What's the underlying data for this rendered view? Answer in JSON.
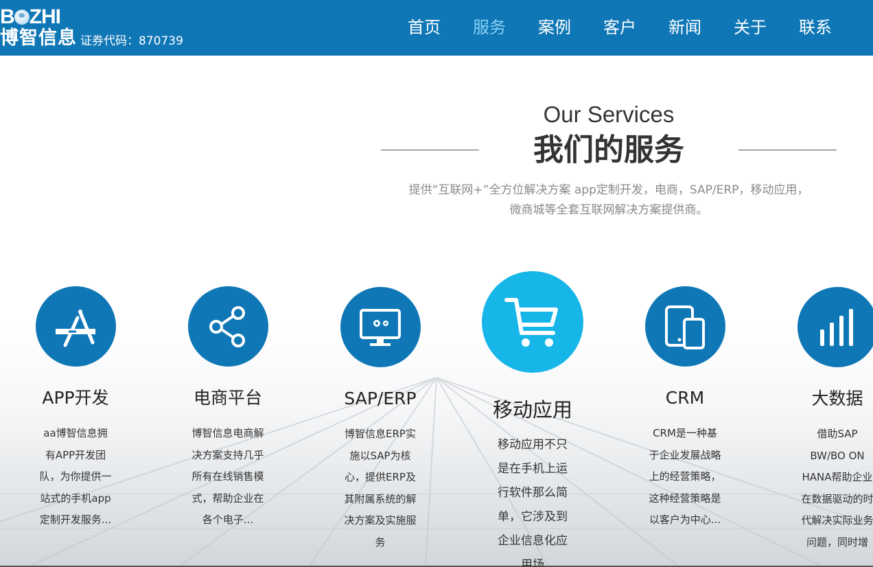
{
  "header": {
    "logo_en_prefix": "B",
    "logo_en_suffix": "ZHI",
    "logo_cn": "博智信息",
    "stock_code": "证券代码：870739",
    "nav": [
      {
        "label": "首页"
      },
      {
        "label": "服务",
        "active": true
      },
      {
        "label": "案例"
      },
      {
        "label": "客户"
      },
      {
        "label": "新闻"
      },
      {
        "label": "关于"
      },
      {
        "label": "联系"
      }
    ]
  },
  "section": {
    "title_en": "Our Services",
    "title_cn": "我们的服务",
    "subtitle": "提供“互联网+”全方位解决方案 app定制开发，电商，SAP/ERP，移动应用，微商城等全套互联网解决方案提供商。"
  },
  "services": [
    {
      "name": "APP开发",
      "icon": "app-store-icon",
      "desc": "aa博智信息拥有APP开发团队，为你提供一站式的手机app定制开发服务..."
    },
    {
      "name": "电商平台",
      "icon": "share-icon",
      "desc": "博智信息电商解决方案支持几乎所有在线销售模式，帮助企业在各个电子..."
    },
    {
      "name": "SAP/ERP",
      "icon": "monitor-gears-icon",
      "desc": "博智信息ERP实施以SAP为核心，提供ERP及其附属系统的解决方案及实施服务"
    },
    {
      "name": "移动应用",
      "icon": "shopping-cart-icon",
      "desc": "移动应用不只是在手机上运行软件那么简单，它涉及到企业信息化应用场",
      "active": true
    },
    {
      "name": "CRM",
      "icon": "tablet-phone-icon",
      "desc": "CRM是一种基于企业发展战略上的经营策略，这种经营策略是以客户为中心..."
    },
    {
      "name": "大数据",
      "icon": "bar-chart-icon",
      "desc": "借助SAP BW/BO ON HANA帮助企业在数据驱动的时代解决实际业务问题，同时增"
    }
  ],
  "colors": {
    "header_bg": "#0f77b6",
    "nav_active": "#8ad0f2",
    "circle": "#0f77b6",
    "circle_active": "#17b6e8"
  }
}
